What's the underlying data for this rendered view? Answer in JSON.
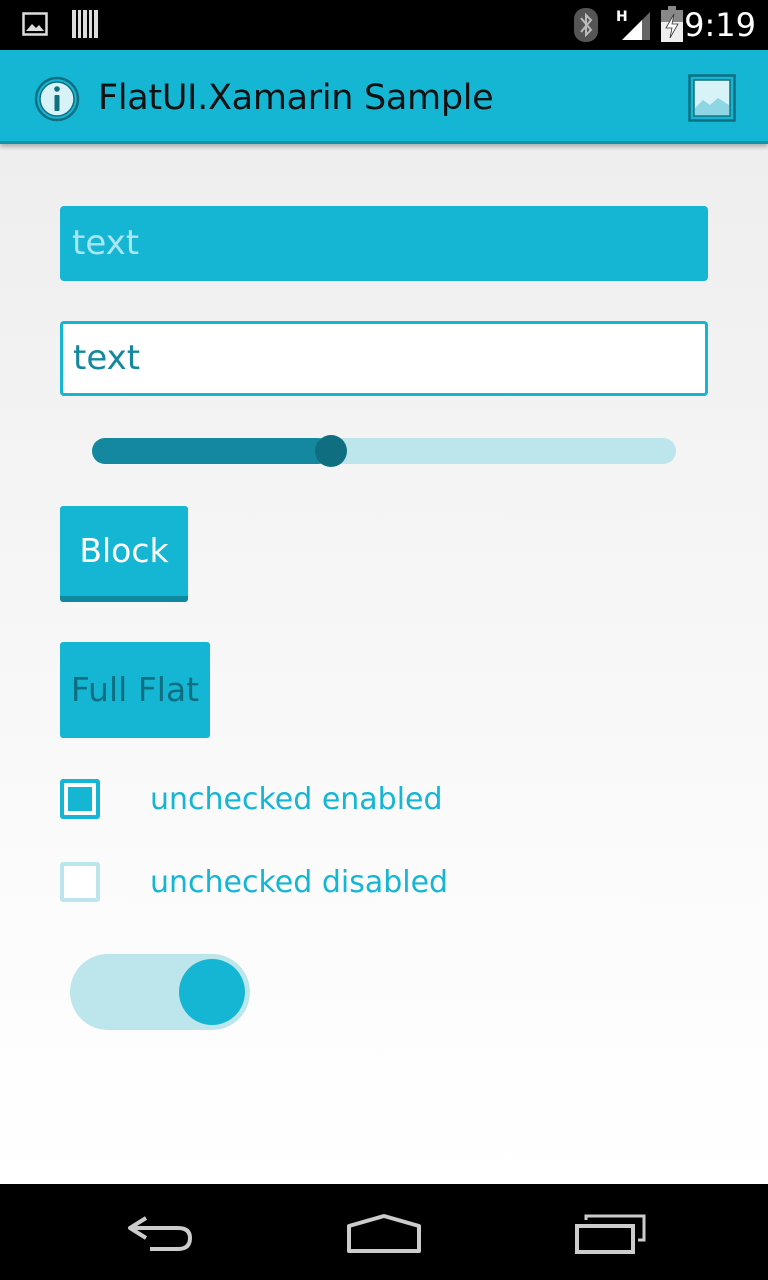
{
  "status_bar": {
    "time": "9:19",
    "icons": [
      "image-notification-icon",
      "barcode-notification-icon",
      "bluetooth-icon",
      "signal-h-icon",
      "battery-charging-icon"
    ]
  },
  "action_bar": {
    "title": "FlatUI.Xamarin Sample",
    "background": "#14b6d4",
    "app_icon": "info-icon",
    "action_icon": "gallery-icon"
  },
  "content": {
    "edit_text_filled": "text",
    "edit_text_outline": "text",
    "slider": {
      "value": 0.41
    },
    "block_button_label": "Block",
    "flat_button_label": "Full Flat",
    "checkbox_enabled_label": "unchecked enabled",
    "checkbox_disabled_label": "unchecked disabled",
    "switch": {
      "on": true
    }
  },
  "colors": {
    "primary": "#14b6d4",
    "primary_dark": "#13889e",
    "primary_light": "#bde5ec",
    "primary_darkest": "#0f6f80"
  },
  "nav_bar": {
    "icons": [
      "back-icon",
      "home-icon",
      "recent-apps-icon"
    ]
  }
}
